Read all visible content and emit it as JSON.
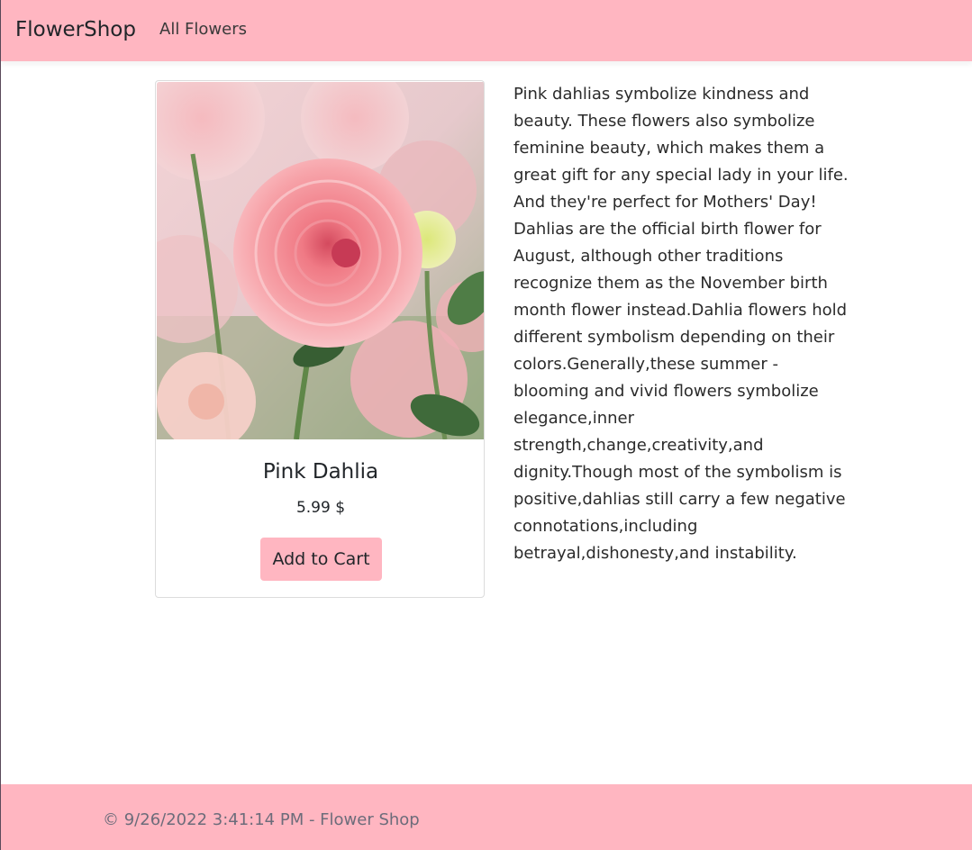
{
  "navbar": {
    "brand": "FlowerShop",
    "links": [
      "All Flowers"
    ]
  },
  "product": {
    "image_alt": "Pink Dahlia",
    "name": "Pink Dahlia",
    "price": "5.99 $",
    "add_to_cart_label": "Add to Cart",
    "description_lines": [
      "Pink dahlias symbolize kindness and",
      "beauty. These flowers also symbolize",
      "feminine beauty, which makes them a",
      "great gift for any special lady in your life.",
      "And they're perfect for Mothers' Day!",
      "Dahlias are the official birth flower for",
      "August, although other traditions",
      "recognize them as the November birth",
      "month flower instead.Dahlia flowers hold",
      "different symbolism depending on their",
      "colors.Generally,these summer -",
      "blooming and vivid flowers symbolize",
      "elegance,inner",
      "strength,change,creativity,and",
      "dignity.Though most of the symbolism is",
      "positive,dahlias still carry a few negative",
      "connotations,including",
      "betrayal,dishonesty,and instability."
    ]
  },
  "footer": {
    "text": "© 9/26/2022 3:41:14 PM - Flower Shop"
  },
  "colors": {
    "accent": "#ffb6c1",
    "text": "#212529"
  }
}
